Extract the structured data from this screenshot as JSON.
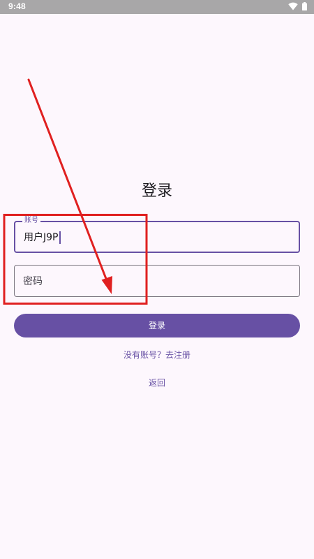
{
  "status_bar": {
    "time": "9:48",
    "icons": [
      "wifi-icon",
      "battery-icon"
    ]
  },
  "login": {
    "title": "登录",
    "account_label": "账号",
    "account_value": "用户J9P",
    "password_placeholder": "密码",
    "submit_label": "登录",
    "register_link": "没有账号？去注册",
    "back_link": "返回"
  },
  "colors": {
    "background": "#fdf7fd",
    "accent": "#6750a4",
    "annotation": "#e02020",
    "status_bar": "#a8a7a8"
  }
}
